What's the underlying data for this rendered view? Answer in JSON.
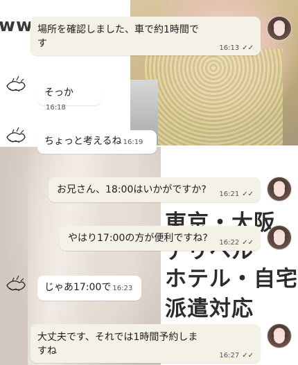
{
  "background": {
    "site_text": "ww.s",
    "promo_lines": [
      "東京・大阪",
      "デリヘル",
      "ホテル・自宅",
      "派遣対応"
    ]
  },
  "messages": [
    {
      "id": "m1",
      "side": "sent",
      "text": "場所を確認しました、車で約1時間で\nす",
      "time": "16:13",
      "read_icon": "double-check-icon"
    },
    {
      "id": "m2",
      "side": "received",
      "text": "そっか",
      "time": "16:18"
    },
    {
      "id": "m3",
      "side": "received",
      "text": "ちょっと考えるね",
      "time": "16:19"
    },
    {
      "id": "m4",
      "side": "sent",
      "text": "お兄さん、18:00はいかがですか?",
      "time": "16:21",
      "read_icon": "double-check-icon"
    },
    {
      "id": "m5",
      "side": "sent",
      "text": "やはり17:00の方が便利ですね?",
      "time": "16:22",
      "read_icon": "double-check-icon"
    },
    {
      "id": "m6",
      "side": "received",
      "text": "じゃあ17:00で",
      "time": "16:23"
    },
    {
      "id": "m7",
      "side": "sent",
      "text": "大丈夫です、それでは1時間予約しま\nすね",
      "time": "16:27",
      "read_icon": "double-check-icon"
    }
  ],
  "colors": {
    "sent_bubble": "#f4f1e6",
    "received_bubble": "#ffffff"
  }
}
